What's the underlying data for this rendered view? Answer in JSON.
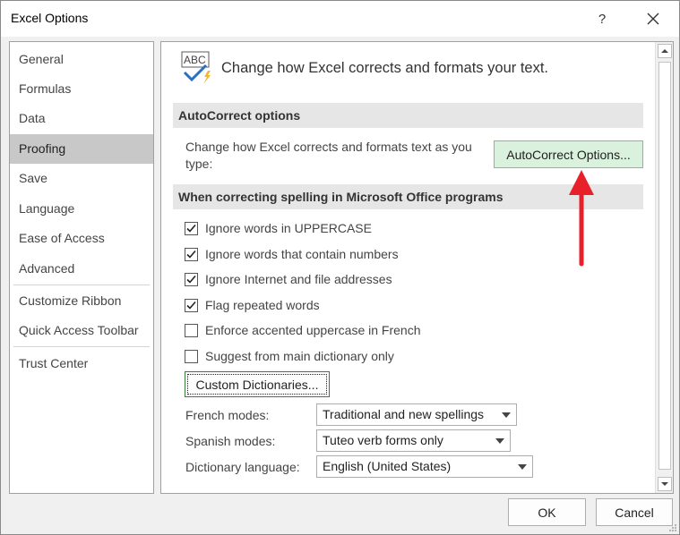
{
  "window": {
    "title": "Excel Options",
    "help": "?"
  },
  "sidebar": {
    "items": [
      {
        "label": "General"
      },
      {
        "label": "Formulas"
      },
      {
        "label": "Data"
      },
      {
        "label": "Proofing",
        "active": true
      },
      {
        "label": "Save"
      },
      {
        "label": "Language"
      },
      {
        "label": "Ease of Access"
      },
      {
        "label": "Advanced"
      },
      {
        "label": "Customize Ribbon"
      },
      {
        "label": "Quick Access Toolbar"
      },
      {
        "label": "Trust Center"
      }
    ]
  },
  "main": {
    "header": "Change how Excel corrects and formats your text.",
    "icon_text": "ABC",
    "autocorrect": {
      "section_title": "AutoCorrect options",
      "description": "Change how Excel corrects and formats text as you type:",
      "button_label": "AutoCorrect Options..."
    },
    "spelling": {
      "section_title": "When correcting spelling in Microsoft Office programs",
      "options": [
        {
          "label": "Ignore words in UPPERCASE",
          "checked": true
        },
        {
          "label": "Ignore words that contain numbers",
          "checked": true
        },
        {
          "label": "Ignore Internet and file addresses",
          "checked": true
        },
        {
          "label": "Flag repeated words",
          "checked": true
        },
        {
          "label": "Enforce accented uppercase in French",
          "checked": false
        },
        {
          "label": "Suggest from main dictionary only",
          "checked": false
        }
      ],
      "custom_dictionaries_label": "Custom Dictionaries...",
      "french_modes": {
        "label": "French modes:",
        "value": "Traditional and new spellings"
      },
      "spanish_modes": {
        "label": "Spanish modes:",
        "value": "Tuteo verb forms only"
      },
      "dictionary_language": {
        "label": "Dictionary language:",
        "value": "English (United States)"
      }
    }
  },
  "footer": {
    "ok_label": "OK",
    "cancel_label": "Cancel"
  },
  "colors": {
    "annotation_arrow": "#e8202a",
    "autocorrect_button_bg": "#d9f1dd"
  }
}
